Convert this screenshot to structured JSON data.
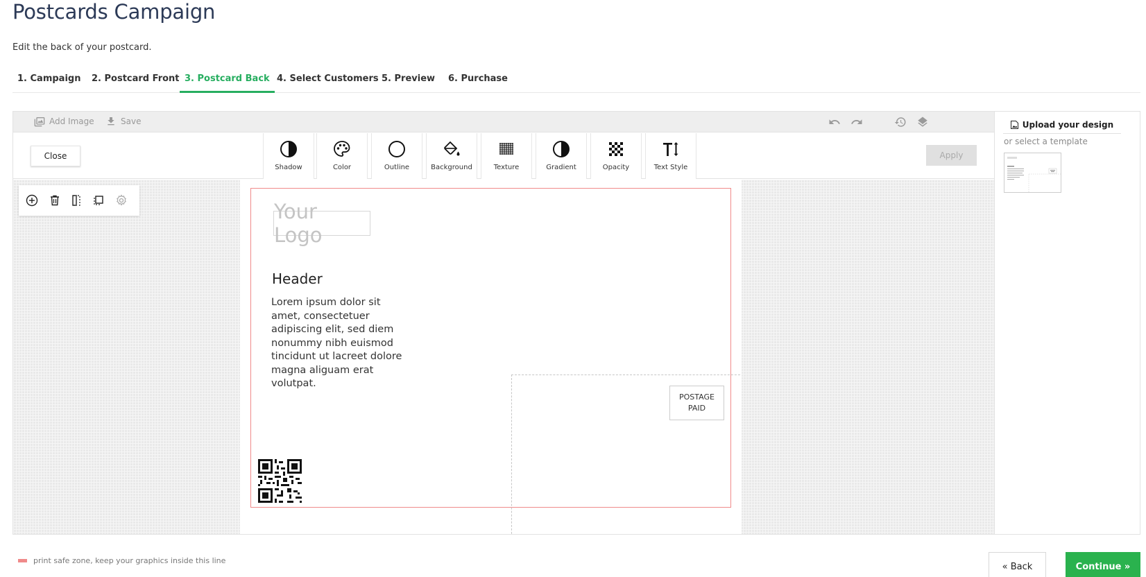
{
  "page": {
    "title": "Postcards Campaign",
    "subtitle": "Edit the back of your postcard."
  },
  "tabs": [
    {
      "label": "1. Campaign",
      "active": false
    },
    {
      "label": "2. Postcard Front",
      "active": false
    },
    {
      "label": "3. Postcard Back",
      "active": true
    },
    {
      "label": "4. Select Customers",
      "active": false
    },
    {
      "label": "5. Preview",
      "active": false
    },
    {
      "label": "6. Purchase",
      "active": false
    }
  ],
  "toolbar": {
    "add_image_label": "Add Image",
    "save_label": "Save",
    "icons": [
      "undo-icon",
      "redo-icon",
      "history-icon",
      "layers-icon"
    ]
  },
  "tools": {
    "close_label": "Close",
    "apply_label": "Apply",
    "items": [
      {
        "label": "Shadow",
        "icon": "shadow-icon"
      },
      {
        "label": "Color",
        "icon": "palette-icon"
      },
      {
        "label": "Outline",
        "icon": "outline-icon"
      },
      {
        "label": "Background",
        "icon": "paint-bucket-icon"
      },
      {
        "label": "Texture",
        "icon": "texture-icon"
      },
      {
        "label": "Gradient",
        "icon": "gradient-icon"
      },
      {
        "label": "Opacity",
        "icon": "checkerboard-icon"
      },
      {
        "label": "Text Style",
        "icon": "text-style-icon"
      }
    ]
  },
  "object_tools": [
    "add-icon",
    "trash-icon",
    "flip-icon",
    "duplicate-icon",
    "settings-icon"
  ],
  "card": {
    "logo_text": "Your Logo",
    "header": "Header",
    "body": "Lorem ipsum dolor sit amet, consectetuer adipiscing elit, sed diem nonummy nibh euismod tincidunt ut lacreet dolore magna aliguam erat volutpat.",
    "postage_line1": "POSTAGE",
    "postage_line2": "PAID"
  },
  "sidebar": {
    "upload_label": "Upload your design",
    "or_template_label": "or select a template"
  },
  "footer": {
    "legend_text": "print safe zone, keep your graphics inside this line",
    "back_label": "« Back",
    "continue_label": "Continue »"
  },
  "colors": {
    "accent": "#27ae60",
    "continue_button": "#2ab24e",
    "title": "#2c3a57",
    "safe_zone": "#f08a8a"
  }
}
